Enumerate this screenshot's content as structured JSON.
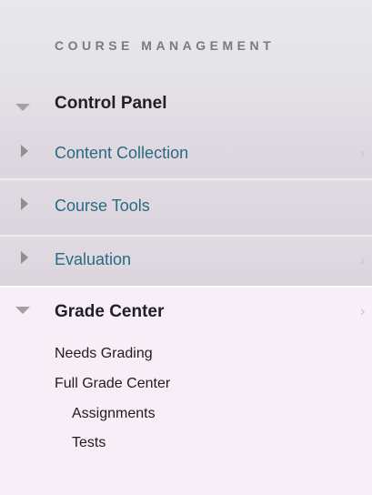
{
  "section_title": "COURSE MANAGEMENT",
  "control_panel": {
    "label": "Control Panel"
  },
  "menu": {
    "items": [
      {
        "label": "Content Collection",
        "icon": "triangle-right-icon"
      },
      {
        "label": "Course Tools",
        "icon": "triangle-right-icon"
      },
      {
        "label": "Evaluation",
        "icon": "triangle-right-icon"
      }
    ]
  },
  "grade_center": {
    "label": "Grade Center",
    "links": [
      "Needs Grading",
      "Full Grade Center"
    ],
    "sublinks": [
      "Assignments",
      "Tests"
    ]
  },
  "colors": {
    "link": "#2a6a82",
    "heading": "#1f1f25",
    "expanded_bg": "#f8eef8"
  }
}
